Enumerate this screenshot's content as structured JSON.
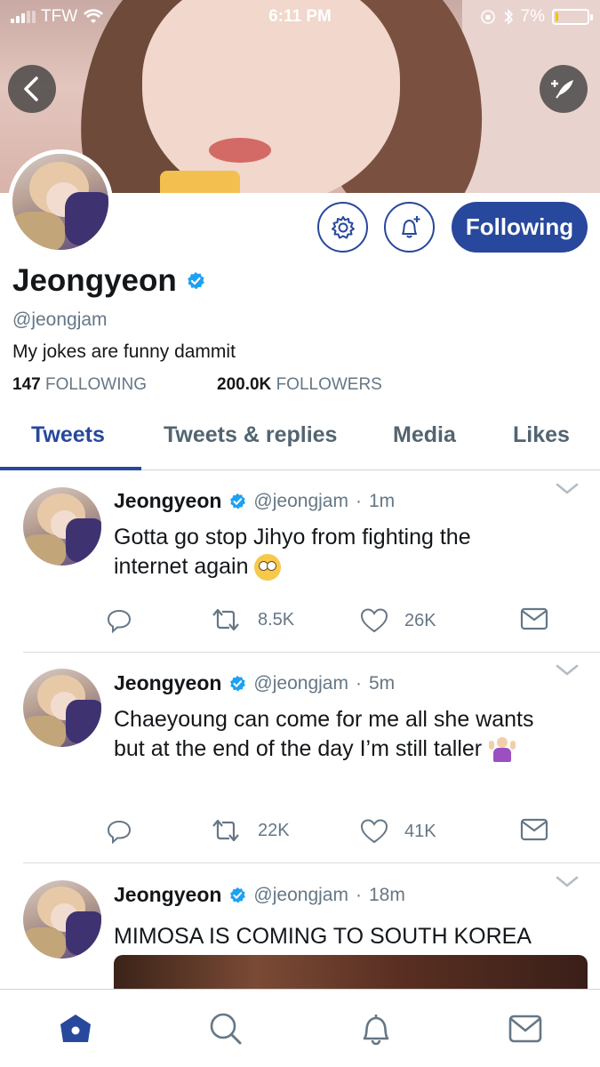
{
  "status_bar": {
    "carrier": "TFW",
    "time": "6:11 PM",
    "battery": "7%",
    "battery_level": 0.07
  },
  "header": {
    "back_icon": "chevron-left-icon",
    "compose_icon": "feather-plus-icon"
  },
  "profile": {
    "name": "Jeongyeon",
    "handle": "@jeongjam",
    "bio": "My jokes are funny dammit",
    "following_count": "147",
    "following_label": "FOLLOWING",
    "followers_count": "200.0K",
    "followers_label": "FOLLOWERS",
    "follow_button": "Following",
    "settings_icon": "gear-icon",
    "notify_icon": "bell-plus-icon"
  },
  "tabs": [
    {
      "label": "Tweets",
      "active": true
    },
    {
      "label": "Tweets & replies",
      "active": false
    },
    {
      "label": "Media",
      "active": false
    },
    {
      "label": "Likes",
      "active": false
    }
  ],
  "tweets": [
    {
      "name": "Jeongyeon",
      "handle": "@jeongjam",
      "time": "1m",
      "text_line1": "Gotta go stop Jihyo from fighting the",
      "text_line2": "internet again",
      "emoji": "face-with-rolling-eyes",
      "retweets": "8.5K",
      "likes": "26K"
    },
    {
      "name": "Jeongyeon",
      "handle": "@jeongjam",
      "time": "5m",
      "text_line1": "Chaeyoung can come for me all she wants",
      "text_line2": "but at the end of the day I’m still taller",
      "emoji": "person-shrugging",
      "retweets": "22K",
      "likes": "41K"
    },
    {
      "name": "Jeongyeon",
      "handle": "@jeongjam",
      "time": "18m",
      "text_line1": "MIMOSA IS COMING TO SOUTH KOREA"
    }
  ],
  "bottom_nav": [
    "home-icon",
    "search-icon",
    "bell-icon",
    "mail-icon"
  ],
  "colors": {
    "accent": "#27489c",
    "verified": "#1da1f2",
    "muted": "#657786"
  }
}
